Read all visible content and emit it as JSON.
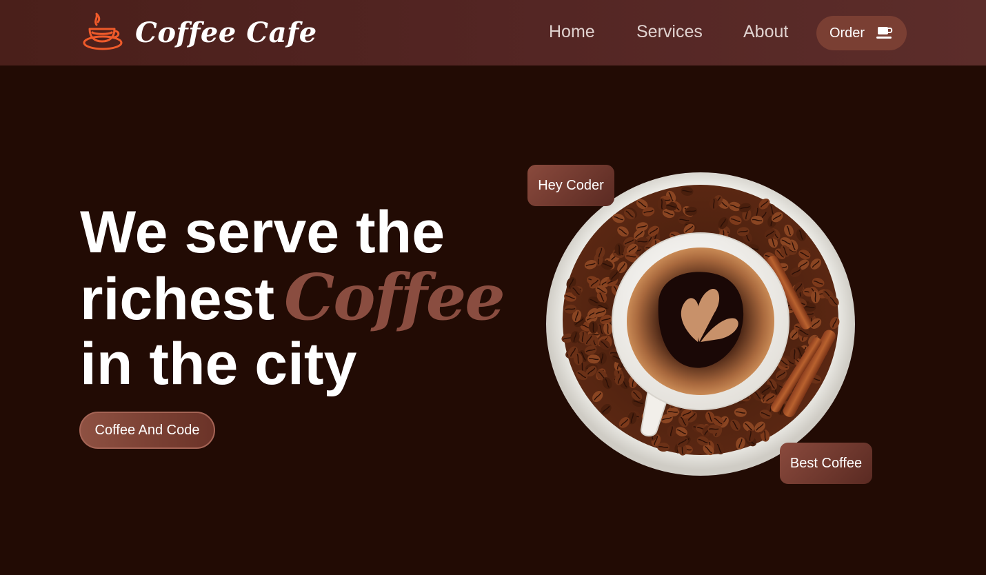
{
  "header": {
    "logo_text": "Coffee Cafe",
    "nav": {
      "home": "Home",
      "services": "Services",
      "about": "About"
    },
    "order_label": "Order"
  },
  "hero": {
    "line1": "We serve the",
    "line2_prefix": "richest",
    "line2_accent": "Coffee",
    "line3": "in the city",
    "cta_label": "Coffee And Code"
  },
  "badges": {
    "top": "Hey Coder",
    "bottom": "Best Coffee"
  },
  "colors": {
    "background": "#220b04",
    "header": "#532523",
    "accent": "#8a4d40",
    "logo_icon": "#ef5a2a",
    "button": "#7a3f33"
  },
  "icons": {
    "logo": "coffee-cup-icon",
    "order": "coffee-cup-icon"
  }
}
